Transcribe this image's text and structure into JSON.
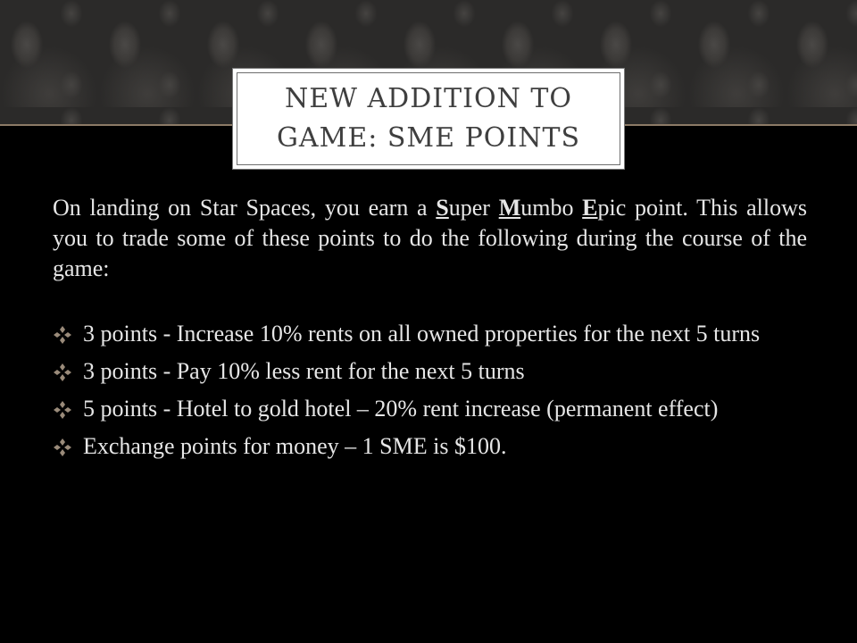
{
  "slide": {
    "title": "New Addition to Game: SME Points",
    "intro": {
      "part1": "On landing on Star Spaces, you earn a ",
      "s_letter": "S",
      "s_rest": "uper ",
      "m_letter": "M",
      "m_rest": "umbo ",
      "e_letter": "E",
      "e_rest": "pic point. This allows you to trade some of these points to do the following during the course of the game:"
    },
    "bullets": [
      "3 points - Increase 10% rents on all owned properties for the next 5 turns",
      "3 points - Pay 10% less rent for the next 5 turns",
      "5 points - Hotel to gold hotel – 20% rent increase (permanent effect)",
      "Exchange points for money – 1 SME is $100."
    ],
    "bullet_icon": "diamond-quad-icon",
    "colors": {
      "background": "#000000",
      "text": "#e6e6e6",
      "title_text": "#3f3f3f",
      "title_box": "#ffffff",
      "header_pattern": "#2b2a29",
      "accent_line": "#8c7a66",
      "bullet_icon": "#9a8b7a"
    }
  }
}
